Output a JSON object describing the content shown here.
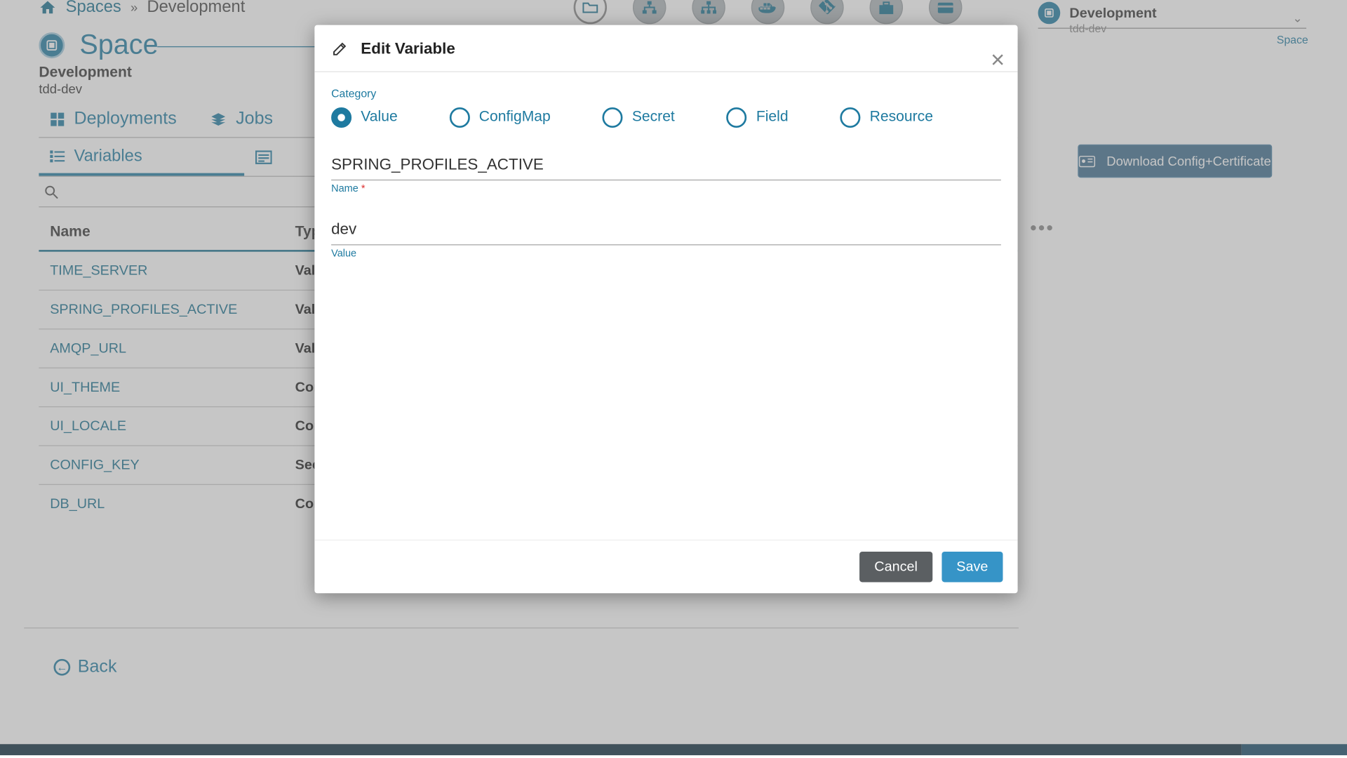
{
  "breadcrumb": {
    "root": "Spaces",
    "current": "Development"
  },
  "page": {
    "title": "Space",
    "subtitle": "Development",
    "subcode": "tdd-dev"
  },
  "tabs": {
    "primary": [
      {
        "label": "Deployments"
      },
      {
        "label": "Jobs"
      }
    ],
    "secondary": [
      {
        "label": "Variables"
      }
    ]
  },
  "table": {
    "headers": {
      "name": "Name",
      "type": "Type"
    },
    "rows": [
      {
        "name": "TIME_SERVER",
        "type": "Value"
      },
      {
        "name": "SPRING_PROFILES_ACTIVE",
        "type": "Value"
      },
      {
        "name": "AMQP_URL",
        "type": "Value"
      },
      {
        "name": "UI_THEME",
        "type": "ConfigMap"
      },
      {
        "name": "UI_LOCALE",
        "type": "ConfigMap"
      },
      {
        "name": "CONFIG_KEY",
        "type": "Secret"
      },
      {
        "name": "DB_URL",
        "type": "ConfigMap"
      }
    ]
  },
  "back_label": "Back",
  "rightPanel": {
    "title": "Development",
    "sub": "tdd-dev",
    "kind": "Space",
    "download": "Download Config+Certificate"
  },
  "modal": {
    "title": "Edit Variable",
    "category_label": "Category",
    "options": {
      "value": "Value",
      "configmap": "ConfigMap",
      "secret": "Secret",
      "field": "Field",
      "resource": "Resource"
    },
    "name_value": "SPRING_PROFILES_ACTIVE",
    "name_label": "Name",
    "value_value": "dev",
    "value_label": "Value",
    "cancel": "Cancel",
    "save": "Save"
  }
}
